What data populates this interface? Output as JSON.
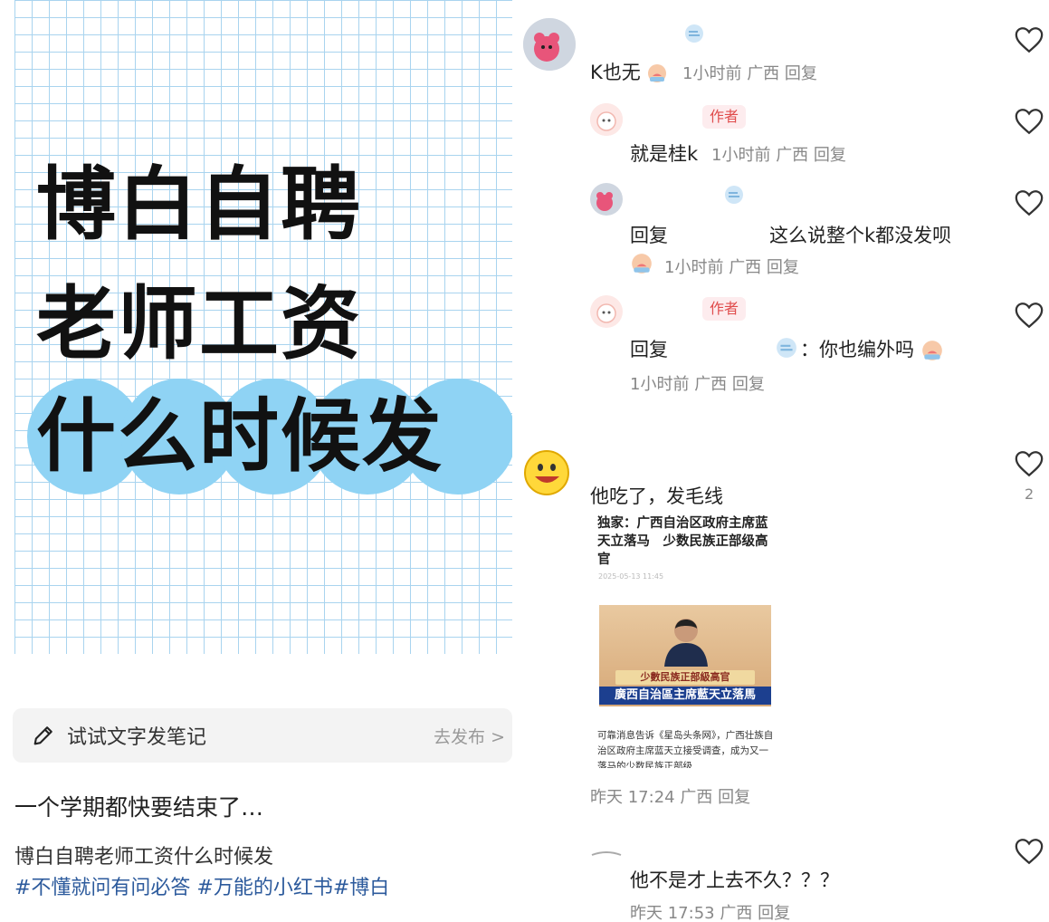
{
  "note": {
    "cover_lines": [
      "博白自聘",
      "老师工资",
      "什么时候发"
    ],
    "composer_placeholder": "试试文字发笔记",
    "composer_action": "去发布 >",
    "title": "一个学期都快要结束了…",
    "description": "博白自聘老师工资什么时候发",
    "tags": "#不懂就问有问必答 #万能的小红书#博白"
  },
  "comments": {
    "c1": {
      "text": "K也无",
      "time": "1小时前",
      "region": "广西",
      "reply": "回复"
    },
    "r1": {
      "tag": "作者",
      "text": "就是桂k",
      "time": "1小时前",
      "region": "广西",
      "reply": "回复"
    },
    "r2": {
      "prefix": "回复",
      "text": "这么说整个k都没发呗",
      "time": "1小时前",
      "region": "广西",
      "reply": "回复"
    },
    "r3": {
      "tag": "作者",
      "prefix": "回复",
      "text": "：你也编外吗",
      "time": "1小时前",
      "region": "广西",
      "reply": "回复"
    },
    "c2": {
      "text": "他吃了，发毛线",
      "like_count": "2",
      "news": {
        "headline": "独家：广西自治区政府主席蓝天立落马　少数民族正部级高官",
        "date": "2025-05-13 11:45",
        "banner_top": "少數民族正部級高官",
        "banner_bottom": "廣西自治區主席藍天立落馬",
        "body": "可靠消息告诉《星岛头条网》，广西壮族自治区政府主席蓝天立接受调查，成为又一落马的少数民族正部级"
      },
      "time": "昨天 17:24",
      "region": "广西",
      "reply": "回复"
    },
    "c3": {
      "text": "他不是才上去不久？？？",
      "time": "昨天 17:53",
      "region": "广西",
      "reply": "回复"
    }
  },
  "icons": {
    "heart": "heart-outline-icon",
    "pencil": "pencil-icon"
  }
}
